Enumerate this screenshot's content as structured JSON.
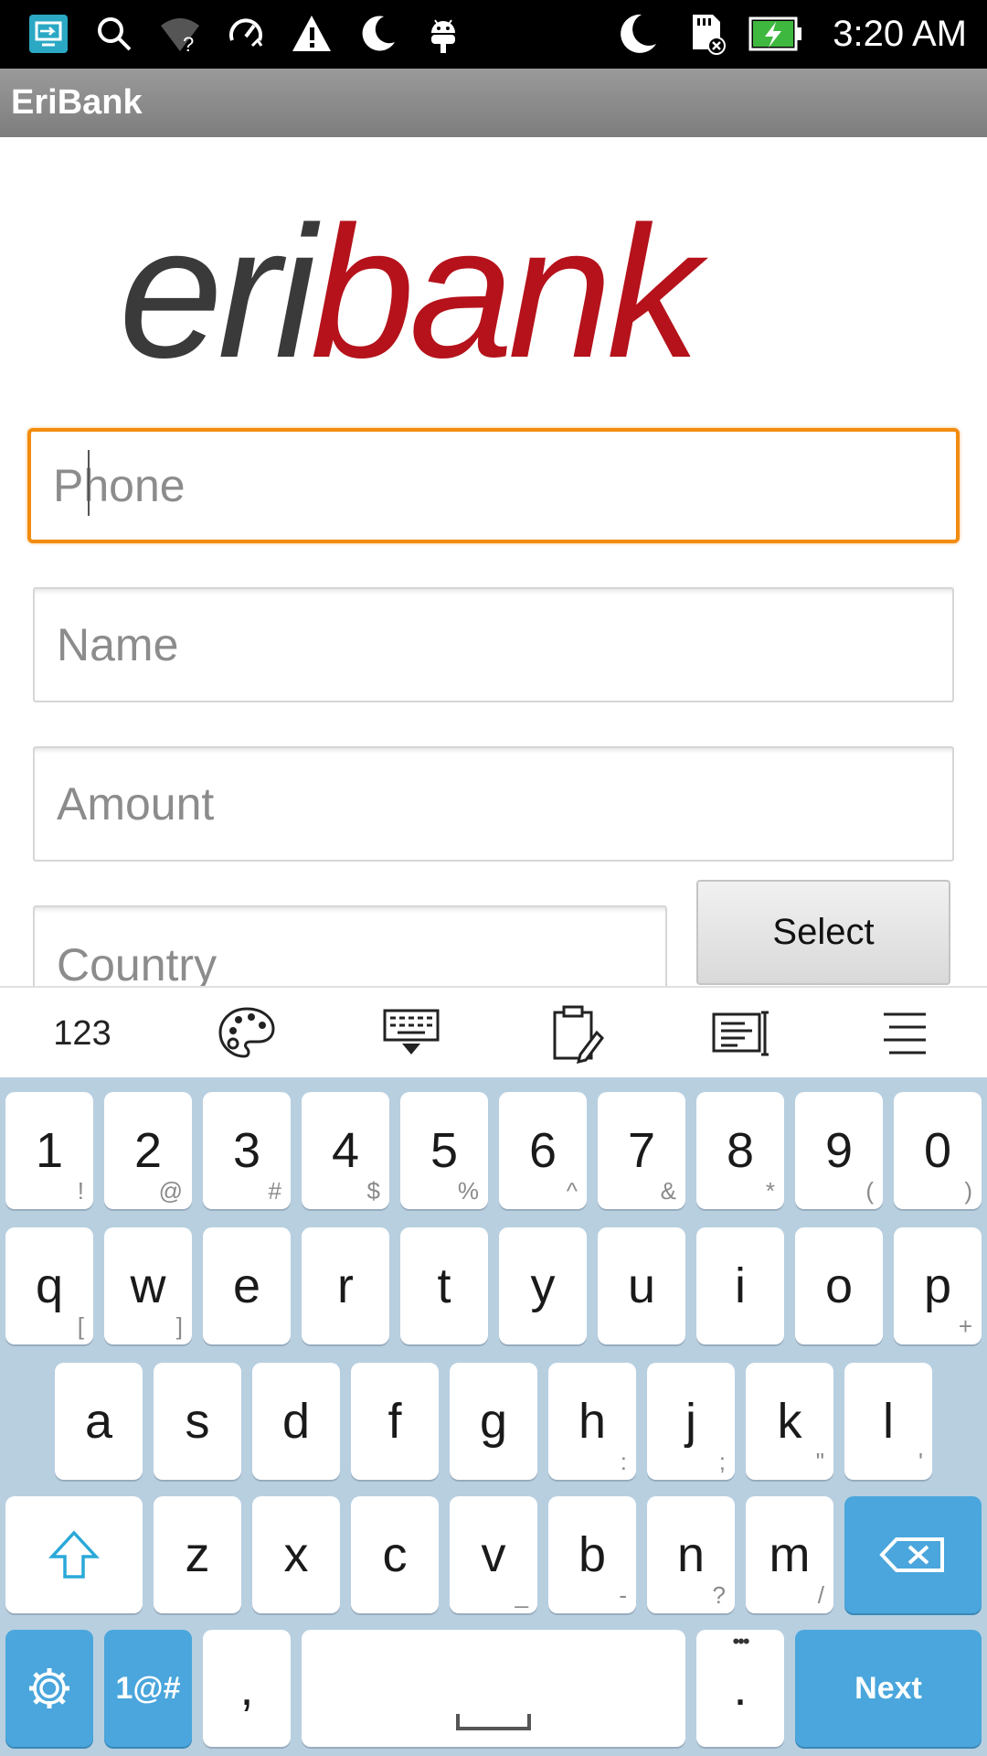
{
  "status_bar": {
    "time": "3:20 AM",
    "icons": [
      "screen-share-icon",
      "search-icon",
      "wifi-unknown-icon",
      "speed-sync-icon",
      "warning-icon",
      "moon-icon",
      "android-icon",
      "night-mode-icon",
      "sd-card-error-icon",
      "battery-charging-icon"
    ]
  },
  "app": {
    "title": "EriBank"
  },
  "logo": {
    "part1": "eri",
    "part2": "bank",
    "color_dark": "#3a3a3a",
    "color_red": "#b5121b"
  },
  "form": {
    "phone_placeholder": "Phone",
    "name_placeholder": "Name",
    "amount_placeholder": "Amount",
    "country_placeholder": "Country",
    "select_label": "Select",
    "focus_color": "#f28c0f"
  },
  "keyboard_toolbar": {
    "numbers_label": "123",
    "icons": [
      "palette-icon",
      "keyboard-hide-icon",
      "clipboard-icon",
      "text-editor-icon",
      "menu-icon"
    ]
  },
  "keyboard": {
    "number_row": [
      {
        "key": "1",
        "sub": "!"
      },
      {
        "key": "2",
        "sub": "@"
      },
      {
        "key": "3",
        "sub": "#"
      },
      {
        "key": "4",
        "sub": "$"
      },
      {
        "key": "5",
        "sub": "%"
      },
      {
        "key": "6",
        "sub": "^"
      },
      {
        "key": "7",
        "sub": "&"
      },
      {
        "key": "8",
        "sub": "*"
      },
      {
        "key": "9",
        "sub": "("
      },
      {
        "key": "0",
        "sub": ")"
      }
    ],
    "row1": [
      {
        "key": "q",
        "sub": "["
      },
      {
        "key": "w",
        "sub": "]"
      },
      {
        "key": "e",
        "sub": ""
      },
      {
        "key": "r",
        "sub": ""
      },
      {
        "key": "t",
        "sub": ""
      },
      {
        "key": "y",
        "sub": ""
      },
      {
        "key": "u",
        "sub": ""
      },
      {
        "key": "i",
        "sub": ""
      },
      {
        "key": "o",
        "sub": ""
      },
      {
        "key": "p",
        "sub": "+"
      }
    ],
    "row2": [
      {
        "key": "a",
        "sub": ""
      },
      {
        "key": "s",
        "sub": ""
      },
      {
        "key": "d",
        "sub": ""
      },
      {
        "key": "f",
        "sub": ""
      },
      {
        "key": "g",
        "sub": ""
      },
      {
        "key": "h",
        "sub": ":"
      },
      {
        "key": "j",
        "sub": ";"
      },
      {
        "key": "k",
        "sub": "\""
      },
      {
        "key": "l",
        "sub": "'"
      }
    ],
    "row3": [
      {
        "key": "z",
        "sub": ""
      },
      {
        "key": "x",
        "sub": ""
      },
      {
        "key": "c",
        "sub": ""
      },
      {
        "key": "v",
        "sub": "_"
      },
      {
        "key": "b",
        "sub": "-"
      },
      {
        "key": "n",
        "sub": "?"
      },
      {
        "key": "m",
        "sub": "/"
      }
    ],
    "symbols_label": "1@#",
    "comma": ",",
    "period": ".",
    "period_extra": "•••",
    "next_label": "Next",
    "accent_color": "#4aa6dc"
  }
}
